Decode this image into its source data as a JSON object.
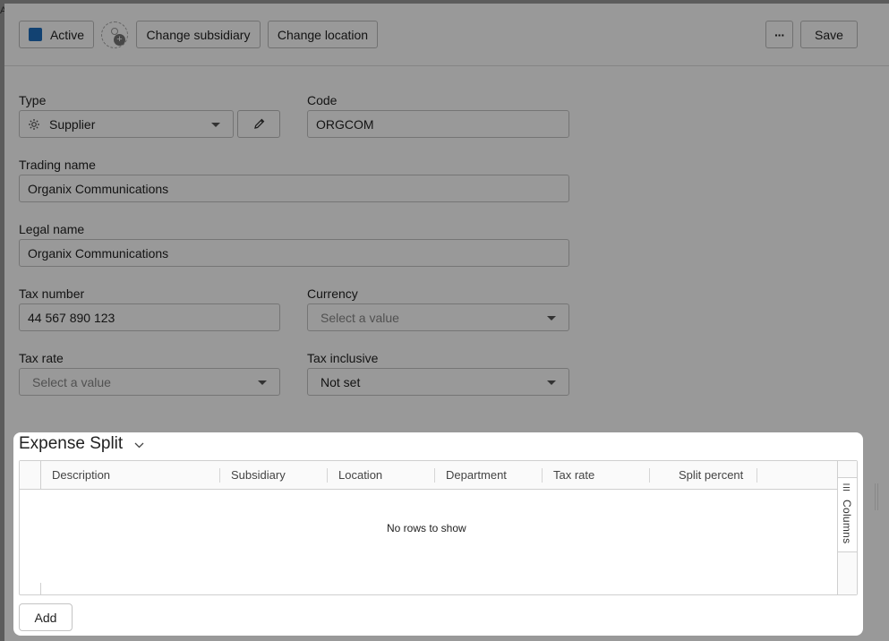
{
  "edge_char": "A",
  "toolbar": {
    "active_label": "Active",
    "change_subsidiary": "Change subsidiary",
    "change_location": "Change location",
    "more_label": "···",
    "save_label": "Save",
    "active_color": "#1f6fbf"
  },
  "form": {
    "type": {
      "label": "Type",
      "value": "Supplier",
      "icon": "gear-icon"
    },
    "code": {
      "label": "Code",
      "value": "ORGCOM"
    },
    "trading_name": {
      "label": "Trading name",
      "value": "Organix Communications"
    },
    "legal_name": {
      "label": "Legal name",
      "value": "Organix Communications"
    },
    "tax_number": {
      "label": "Tax number",
      "value": "44 567 890 123"
    },
    "currency": {
      "label": "Currency",
      "placeholder": "Select a value"
    },
    "tax_rate": {
      "label": "Tax rate",
      "placeholder": "Select a value"
    },
    "tax_inclusive": {
      "label": "Tax inclusive",
      "value": "Not set"
    }
  },
  "expense_split": {
    "title": "Expense Split",
    "columns": [
      "Description",
      "Subsidiary",
      "Location",
      "Department",
      "Tax rate",
      "Split percent"
    ],
    "empty_text": "No rows to show",
    "side_panel_label": "Columns",
    "add_label": "Add"
  }
}
